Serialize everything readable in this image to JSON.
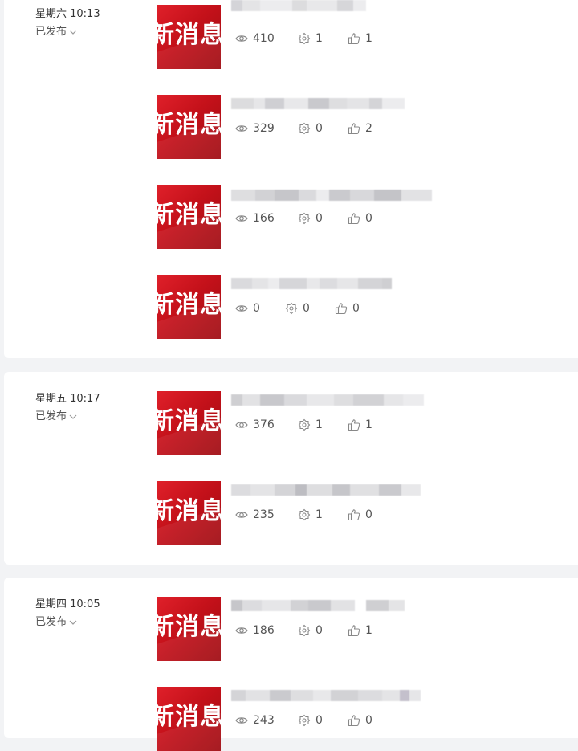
{
  "thumbnail_text": "新消息",
  "groups": [
    {
      "date": "星期六 10:13",
      "status": "已发布",
      "articles": [
        {
          "views": "410",
          "shares": "1",
          "likes": "1"
        },
        {
          "views": "329",
          "shares": "0",
          "likes": "2"
        },
        {
          "views": "166",
          "shares": "0",
          "likes": "0"
        },
        {
          "views": "0",
          "shares": "0",
          "likes": "0"
        }
      ]
    },
    {
      "date": "星期五 10:17",
      "status": "已发布",
      "articles": [
        {
          "views": "376",
          "shares": "1",
          "likes": "1"
        },
        {
          "views": "235",
          "shares": "1",
          "likes": "0"
        }
      ]
    },
    {
      "date": "星期四 10:05",
      "status": "已发布",
      "articles": [
        {
          "views": "186",
          "shares": "0",
          "likes": "1"
        },
        {
          "views": "243",
          "shares": "0",
          "likes": "0"
        }
      ]
    }
  ],
  "icons": {
    "views": "eye-icon",
    "shares": "share-icon",
    "likes": "thumbs-up-icon",
    "status": "chevron-down-icon"
  },
  "colors": {
    "background": "#f2f3f5",
    "card": "#ffffff",
    "thumbnail_red": "#c8121b",
    "text": "#333333",
    "muted": "#999999"
  }
}
